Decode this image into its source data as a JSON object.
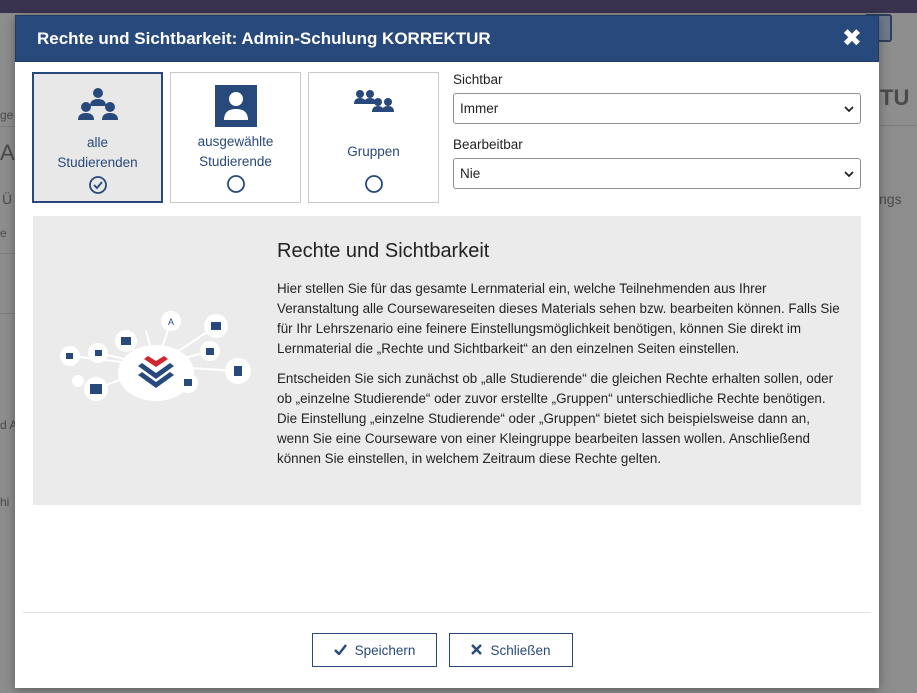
{
  "background": {
    "fragments": [
      "ge",
      "Ar",
      "Ü",
      "e",
      "d A",
      "ngs",
      "hi",
      "TU"
    ]
  },
  "dialog": {
    "title": "Rechte und Sichtbarkeit: Admin-Schulung KORREKTUR",
    "close_label": "✖",
    "options": [
      {
        "label_line1": "alle",
        "label_line2": "Studierenden",
        "selected": true,
        "icon": "users-group-icon"
      },
      {
        "label_line1": "ausgewählte",
        "label_line2": "Studierende",
        "selected": false,
        "icon": "user-card-icon"
      },
      {
        "label_line1": "Gruppen",
        "label_line2": "",
        "selected": false,
        "icon": "groups-icon"
      }
    ],
    "visible": {
      "label": "Sichtbar",
      "value": "Immer"
    },
    "editable": {
      "label": "Bearbeitbar",
      "value": "Nie"
    },
    "info": {
      "title": "Rechte und Sichtbarkeit",
      "paragraph1": "Hier stellen Sie für das gesamte Lernmaterial ein, welche Teilnehmenden aus Ihrer Veranstaltung alle Coursewareseiten dieses Materials sehen bzw. bearbeiten können. Falls Sie für Ihr Lehrszenario eine feinere Einstellungsmöglichkeit benötigen, können Sie direkt im Lernmaterial die „Rechte und Sichtbarkeit“ an den einzelnen Seiten einstellen.",
      "paragraph2": "Entscheiden Sie sich zunächst ob „alle Studierende“ die gleichen Rechte erhalten sollen, oder ob „einzelne Studierende“ oder zuvor erstellte „Gruppen“ unterschiedliche Rechte benötigen. Die Einstellung „einzelne Studierende“ oder „Gruppen“ bietet sich beispielsweise dann an, wenn Sie eine Courseware von einer Kleingruppe bearbeiten lassen wollen. Anschließend können Sie einstellen, in welchem Zeitraum diese Rechte gelten."
    },
    "buttons": {
      "save": "Speichern",
      "close": "Schließen"
    },
    "colors": {
      "primary": "#28497c",
      "accent_red": "#d0262d"
    }
  }
}
